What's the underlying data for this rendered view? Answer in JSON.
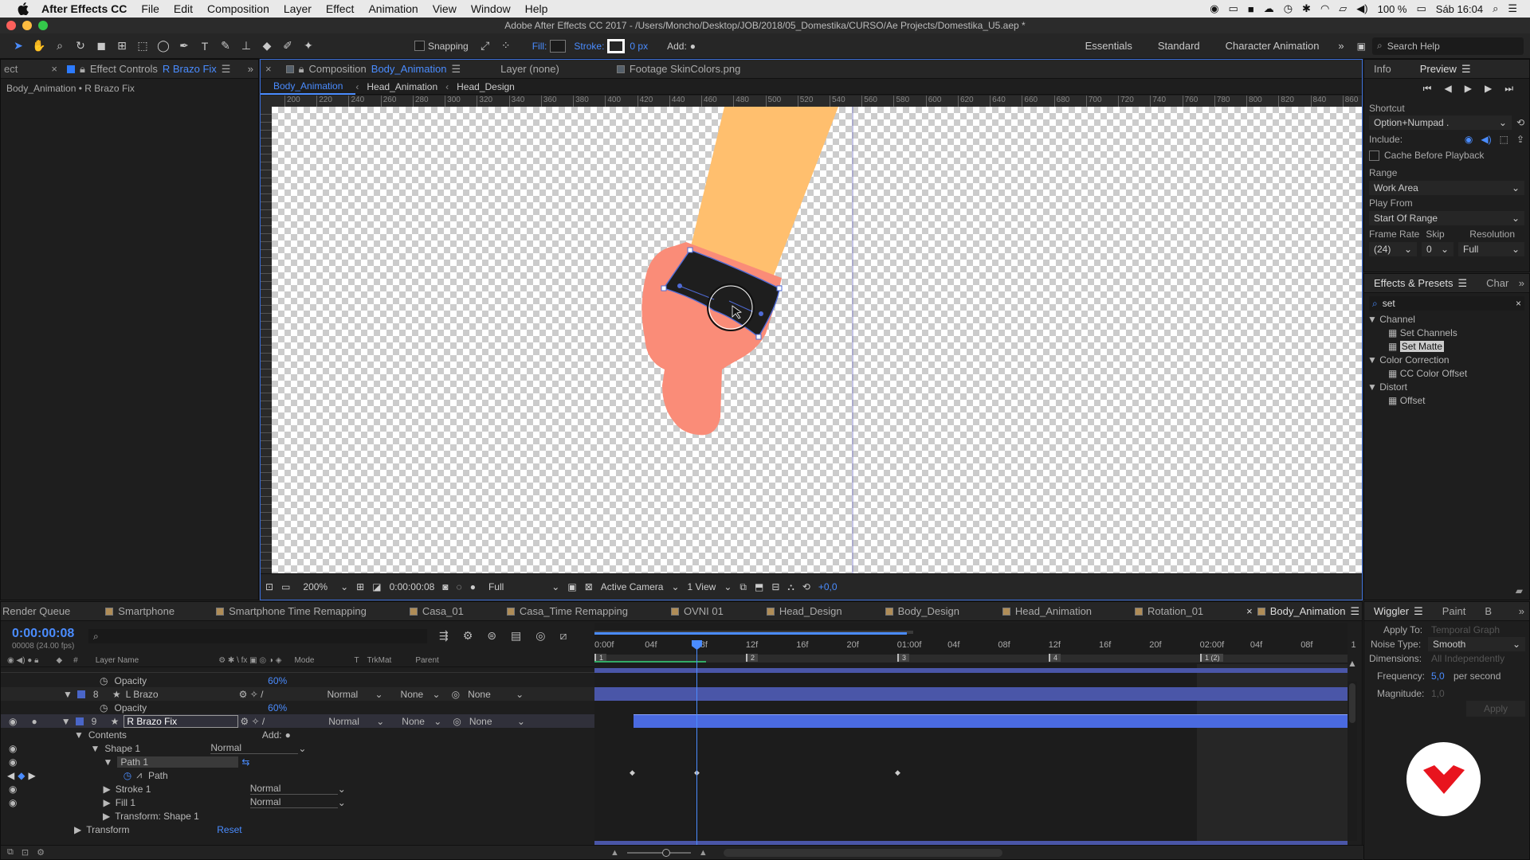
{
  "menubar": {
    "app": "After Effects CC",
    "items": [
      "File",
      "Edit",
      "Composition",
      "Layer",
      "Effect",
      "Animation",
      "View",
      "Window",
      "Help"
    ],
    "battery": "100 %",
    "clock": "Sáb 16:04"
  },
  "window_title": "Adobe After Effects CC 2017 - /Users/Moncho/Desktop/JOB/2018/05_Domestika/CURSO/Ae Projects/Domestika_U5.aep *",
  "toolbar": {
    "snapping_label": "Snapping",
    "fill_label": "Fill:",
    "stroke_label": "Stroke:",
    "stroke_width": "0 px",
    "add_label": "Add:",
    "workspaces": [
      "Essentials",
      "Standard",
      "Character Animation"
    ],
    "search_placeholder": "Search Help"
  },
  "effect_controls": {
    "tab_left": "ect",
    "tab_label": "Effect Controls",
    "tab_layer": "R Brazo Fix",
    "breadcrumb": "Body_Animation • R Brazo Fix"
  },
  "composition": {
    "tab_label": "Composition",
    "tab_comp": "Body_Animation",
    "layer_tab": "Layer (none)",
    "footage_tab": "Footage SkinColors.png",
    "flow": [
      "Body_Animation",
      "Head_Animation",
      "Head_Design"
    ],
    "ruler_ticks": [
      "200",
      "220",
      "240",
      "260",
      "280",
      "300",
      "320",
      "340",
      "360",
      "380",
      "400",
      "420",
      "440",
      "460",
      "480",
      "500",
      "520",
      "540",
      "560",
      "580",
      "600",
      "620",
      "640",
      "660",
      "680",
      "700",
      "720",
      "740",
      "760",
      "780",
      "800",
      "820",
      "840",
      "860"
    ],
    "footer": {
      "zoom": "200%",
      "timecode": "0:00:00:08",
      "resolution": "Full",
      "camera": "Active Camera",
      "views": "1 View",
      "exposure": "+0,0"
    }
  },
  "preview": {
    "tabs": [
      "Info",
      "Preview"
    ],
    "shortcut_label": "Shortcut",
    "shortcut_value": "Option+Numpad .",
    "include_label": "Include:",
    "cache_label": "Cache Before Playback",
    "range_label": "Range",
    "range_value": "Work Area",
    "play_from_label": "Play From",
    "play_from_value": "Start Of Range",
    "frame_rate_label": "Frame Rate",
    "skip_label": "Skip",
    "resolution_label": "Resolution",
    "frame_rate_value": "(24)",
    "skip_value": "0",
    "resolution_value": "Full"
  },
  "effects_presets": {
    "tabs": [
      "Effects & Presets",
      "Char"
    ],
    "search_value": "set",
    "groups": [
      {
        "name": "Channel",
        "items": [
          "Set Channels",
          "Set Matte"
        ]
      },
      {
        "name": "Color Correction",
        "items": [
          "CC Color Offset"
        ]
      },
      {
        "name": "Distort",
        "items": [
          "Offset"
        ]
      }
    ]
  },
  "timeline": {
    "tabs": [
      "Render Queue",
      "Smartphone",
      "Smartphone Time Remapping",
      "Casa_01",
      "Casa_Time Remapping",
      "OVNI 01",
      "Head_Design",
      "Body_Design",
      "Head_Animation",
      "Rotation_01",
      "Body_Animation"
    ],
    "timecode": "0:00:00:08",
    "fps": "00008 (24.00 fps)",
    "columns": {
      "num": "#",
      "layer_name": "Layer Name",
      "mode": "Mode",
      "t": "T",
      "trkmat": "TrkMat",
      "parent": "Parent"
    },
    "ruler": [
      "0:00f",
      "04f",
      "08f",
      "12f",
      "16f",
      "20f",
      "01:00f",
      "04f",
      "08f",
      "12f",
      "16f",
      "20f",
      "02:00f",
      "04f",
      "08f",
      "1"
    ],
    "markers": [
      "1",
      "2",
      "3",
      "4",
      "1 (2)"
    ],
    "rows": {
      "opacity1_label": "Opacity",
      "opacity1_value": "60%",
      "layer8_num": "8",
      "layer8_name": "L Brazo",
      "layer8_mode": "Normal",
      "layer8_trkmat": "None",
      "layer8_parent": "None",
      "opacity2_label": "Opacity",
      "opacity2_value": "60%",
      "layer9_num": "9",
      "layer9_name": "R Brazo Fix",
      "layer9_mode": "Normal",
      "layer9_trkmat": "None",
      "layer9_parent": "None",
      "contents_label": "Contents",
      "add_label": "Add:",
      "shape1_label": "Shape 1",
      "shape1_mode": "Normal",
      "path1_label": "Path 1",
      "path_label": "Path",
      "stroke1_label": "Stroke 1",
      "stroke1_mode": "Normal",
      "fill1_label": "Fill 1",
      "fill1_mode": "Normal",
      "transform_shape_label": "Transform: Shape 1",
      "transform_label": "Transform",
      "reset_label": "Reset"
    }
  },
  "wiggler": {
    "tabs": [
      "Wiggler",
      "Paint",
      "B"
    ],
    "apply_to_label": "Apply To:",
    "apply_to_value": "Temporal Graph",
    "noise_label": "Noise Type:",
    "noise_value": "Smooth",
    "dimensions_label": "Dimensions:",
    "dimensions_value": "All Independently",
    "frequency_label": "Frequency:",
    "frequency_value": "5,0",
    "frequency_unit": "per second",
    "magnitude_label": "Magnitude:",
    "magnitude_value": "1,0",
    "apply_button": "Apply"
  },
  "colors": {
    "accent": "#4a8cff",
    "arm": "#ffbf6e",
    "hand": "#fa8c78",
    "shape": "#1e1e1e",
    "layer_bar": "#4a56a8",
    "logo": "#e8141e"
  }
}
